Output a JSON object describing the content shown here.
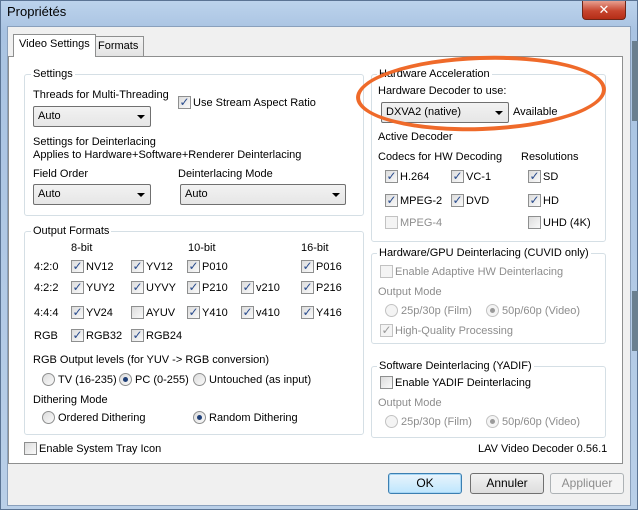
{
  "window": {
    "title": "Propriétés",
    "close": "✕"
  },
  "tabs": [
    {
      "label": "Video Settings"
    },
    {
      "label": "Formats"
    }
  ],
  "settings": {
    "title": "Settings",
    "threads_label": "Threads for Multi-Threading",
    "threads_value": "Auto",
    "stream_aspect": "Use Stream Aspect Ratio",
    "deint_title": "Settings for Deinterlacing",
    "deint_desc": "Applies to Hardware+Software+Renderer Deinterlacing",
    "field_order_label": "Field Order",
    "field_order_value": "Auto",
    "deint_mode_label": "Deinterlacing Mode",
    "deint_mode_value": "Auto"
  },
  "hw": {
    "title": "Hardware Acceleration",
    "decoder_label": "Hardware Decoder to use:",
    "decoder_value": "DXVA2 (native)",
    "status": "Available",
    "active_decoder": "Active Decoder",
    "codecs_label": "Codecs for HW Decoding",
    "res_label": "Resolutions",
    "codecs": [
      "H.264",
      "VC-1",
      "MPEG-2",
      "DVD",
      "MPEG-4"
    ],
    "resolutions": [
      "SD",
      "HD",
      "UHD (4K)"
    ]
  },
  "output": {
    "title": "Output Formats",
    "col_8bit": "8-bit",
    "col_10bit": "10-bit",
    "col_16bit": "16-bit",
    "row_420": "4:2:0",
    "row_422": "4:2:2",
    "row_444": "4:4:4",
    "row_rgb": "RGB",
    "fmt": [
      "NV12",
      "YV12",
      "P010",
      "P016",
      "YUY2",
      "UYVY",
      "P210",
      "v210",
      "P216",
      "YV24",
      "AYUV",
      "Y410",
      "v410",
      "Y416",
      "RGB32",
      "RGB24"
    ],
    "rgb_levels_label": "RGB Output levels (for YUV -> RGB conversion)",
    "tv": "TV (16-235)",
    "pc": "PC (0-255)",
    "untouched": "Untouched (as input)",
    "dither_label": "Dithering Mode",
    "ordered": "Ordered Dithering",
    "random": "Random Dithering"
  },
  "cuvid": {
    "title": "Hardware/GPU Deinterlacing (CUVID only)",
    "adaptive": "Enable Adaptive HW Deinterlacing",
    "output_mode": "Output Mode",
    "film": "25p/30p (Film)",
    "video": "50p/60p (Video)",
    "hq": "High-Quality Processing"
  },
  "yadif": {
    "title": "Software Deinterlacing (YADIF)",
    "enable": "Enable YADIF Deinterlacing",
    "output_mode": "Output Mode",
    "film": "25p/30p (Film)",
    "video": "50p/60p (Video)"
  },
  "tray": "Enable System Tray Icon",
  "version": "LAV Video Decoder 0.56.1",
  "buttons": {
    "ok": "OK",
    "cancel": "Annuler",
    "apply": "Appliquer"
  },
  "colors": {
    "annotation": "#ef6a2a",
    "title_bar": "#bcd3ec",
    "check": "#2a4c8d"
  },
  "marks": {
    "check": "✓"
  }
}
